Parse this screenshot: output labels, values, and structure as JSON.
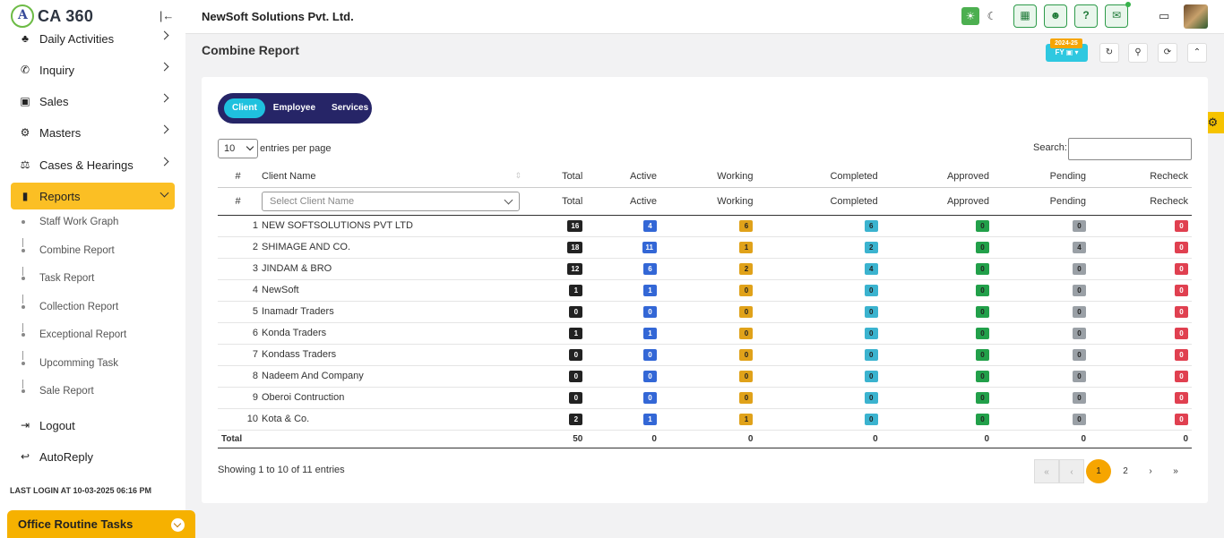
{
  "app": {
    "logo_text": "CA 360",
    "company": "NewSoft Solutions Pvt. Ltd."
  },
  "sidebar": {
    "items": [
      {
        "label": "Daily Activities",
        "icon": "sun-icon"
      },
      {
        "label": "Inquiry",
        "icon": "phone-icon"
      },
      {
        "label": "Sales",
        "icon": "money-icon"
      },
      {
        "label": "Masters",
        "icon": "gears-icon"
      },
      {
        "label": "Cases & Hearings",
        "icon": "scale-icon"
      },
      {
        "label": "Reports",
        "icon": "report-icon",
        "active": true
      }
    ],
    "sub_items": [
      "Staff Work Graph",
      "Combine Report",
      "Task Report",
      "Collection Report",
      "Exceptional Report",
      "Upcomming Task",
      "Sale Report"
    ],
    "logout": "Logout",
    "autoreply": "AutoReply",
    "last_login": "LAST LOGIN AT 10-03-2025 06:16 PM",
    "routine": "Office Routine Tasks"
  },
  "page": {
    "title": "Combine Report",
    "fy_badge": "2024-25",
    "fy_label": "FY ▣ ▾"
  },
  "tabs": [
    "Client",
    "Employee",
    "Services"
  ],
  "table": {
    "entries_value": "10",
    "entries_text": "entries per page",
    "search_label": "Search:",
    "headers": [
      "#",
      "Client Name",
      "Total",
      "Active",
      "Working",
      "Completed",
      "Approved",
      "Pending",
      "Recheck"
    ],
    "filter_placeholder": "Select Client Name",
    "rows": [
      {
        "idx": "1",
        "name": "NEW SOFTSOLUTIONS PVT LTD",
        "vals": [
          "16",
          "4",
          "6",
          "6",
          "0",
          "0",
          "0"
        ]
      },
      {
        "idx": "2",
        "name": "SHIMAGE AND CO.",
        "vals": [
          "18",
          "11",
          "1",
          "2",
          "0",
          "4",
          "0"
        ]
      },
      {
        "idx": "3",
        "name": "JINDAM & BRO",
        "vals": [
          "12",
          "6",
          "2",
          "4",
          "0",
          "0",
          "0"
        ]
      },
      {
        "idx": "4",
        "name": "NewSoft",
        "vals": [
          "1",
          "1",
          "0",
          "0",
          "0",
          "0",
          "0"
        ]
      },
      {
        "idx": "5",
        "name": "Inamadr Traders",
        "vals": [
          "0",
          "0",
          "0",
          "0",
          "0",
          "0",
          "0"
        ]
      },
      {
        "idx": "6",
        "name": "Konda Traders",
        "vals": [
          "1",
          "1",
          "0",
          "0",
          "0",
          "0",
          "0"
        ]
      },
      {
        "idx": "7",
        "name": "Kondass Traders",
        "vals": [
          "0",
          "0",
          "0",
          "0",
          "0",
          "0",
          "0"
        ]
      },
      {
        "idx": "8",
        "name": "Nadeem And Company",
        "vals": [
          "0",
          "0",
          "0",
          "0",
          "0",
          "0",
          "0"
        ]
      },
      {
        "idx": "9",
        "name": "Oberoi Contruction",
        "vals": [
          "0",
          "0",
          "0",
          "0",
          "0",
          "0",
          "0"
        ]
      },
      {
        "idx": "10",
        "name": "Kota & Co.",
        "vals": [
          "2",
          "1",
          "1",
          "0",
          "0",
          "0",
          "0"
        ]
      }
    ],
    "total_label": "Total",
    "totals": [
      "50",
      "0",
      "0",
      "0",
      "0",
      "0",
      "0"
    ],
    "showing": "Showing 1 to 10 of 11 entries",
    "pages": [
      "«",
      "‹",
      "1",
      "2",
      "›",
      "»"
    ]
  },
  "badge_colors": [
    "dark",
    "blue",
    "yellow",
    "cyan",
    "green",
    "gray",
    "red"
  ]
}
